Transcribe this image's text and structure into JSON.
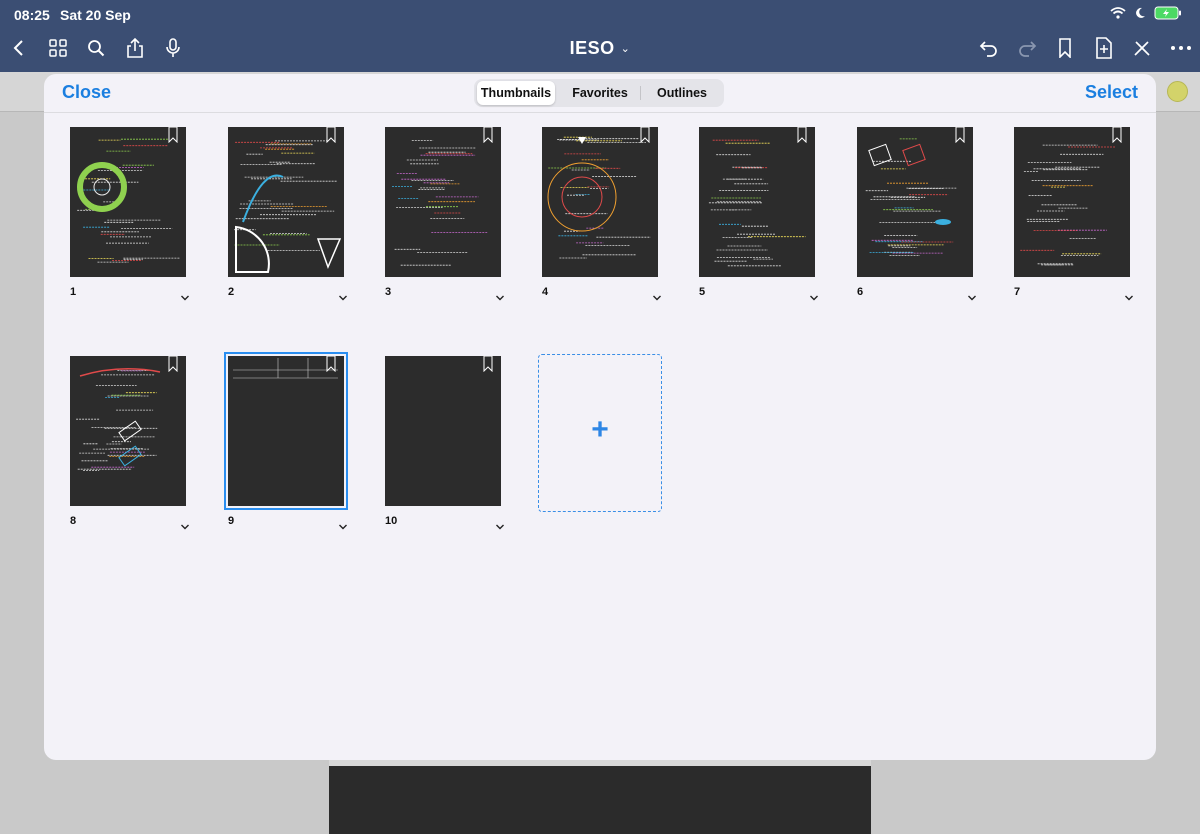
{
  "status": {
    "time": "08:25",
    "date": "Sat 20 Sep"
  },
  "toolbar": {
    "title": "IESO"
  },
  "modal": {
    "close_label": "Close",
    "select_label": "Select",
    "tabs": [
      {
        "label": "Thumbnails",
        "active": true
      },
      {
        "label": "Favorites",
        "active": false
      },
      {
        "label": "Outlines",
        "active": false
      }
    ]
  },
  "pages": [
    {
      "number": "1"
    },
    {
      "number": "2"
    },
    {
      "number": "3"
    },
    {
      "number": "4"
    },
    {
      "number": "5"
    },
    {
      "number": "6"
    },
    {
      "number": "7"
    },
    {
      "number": "8"
    },
    {
      "number": "9",
      "selected": true
    },
    {
      "number": "10"
    }
  ],
  "add_page_icon": "+",
  "colors": {
    "accent": "#1b7fe0",
    "toolbar": "#3b4e73",
    "thumb_bg": "#2c2c2c"
  }
}
